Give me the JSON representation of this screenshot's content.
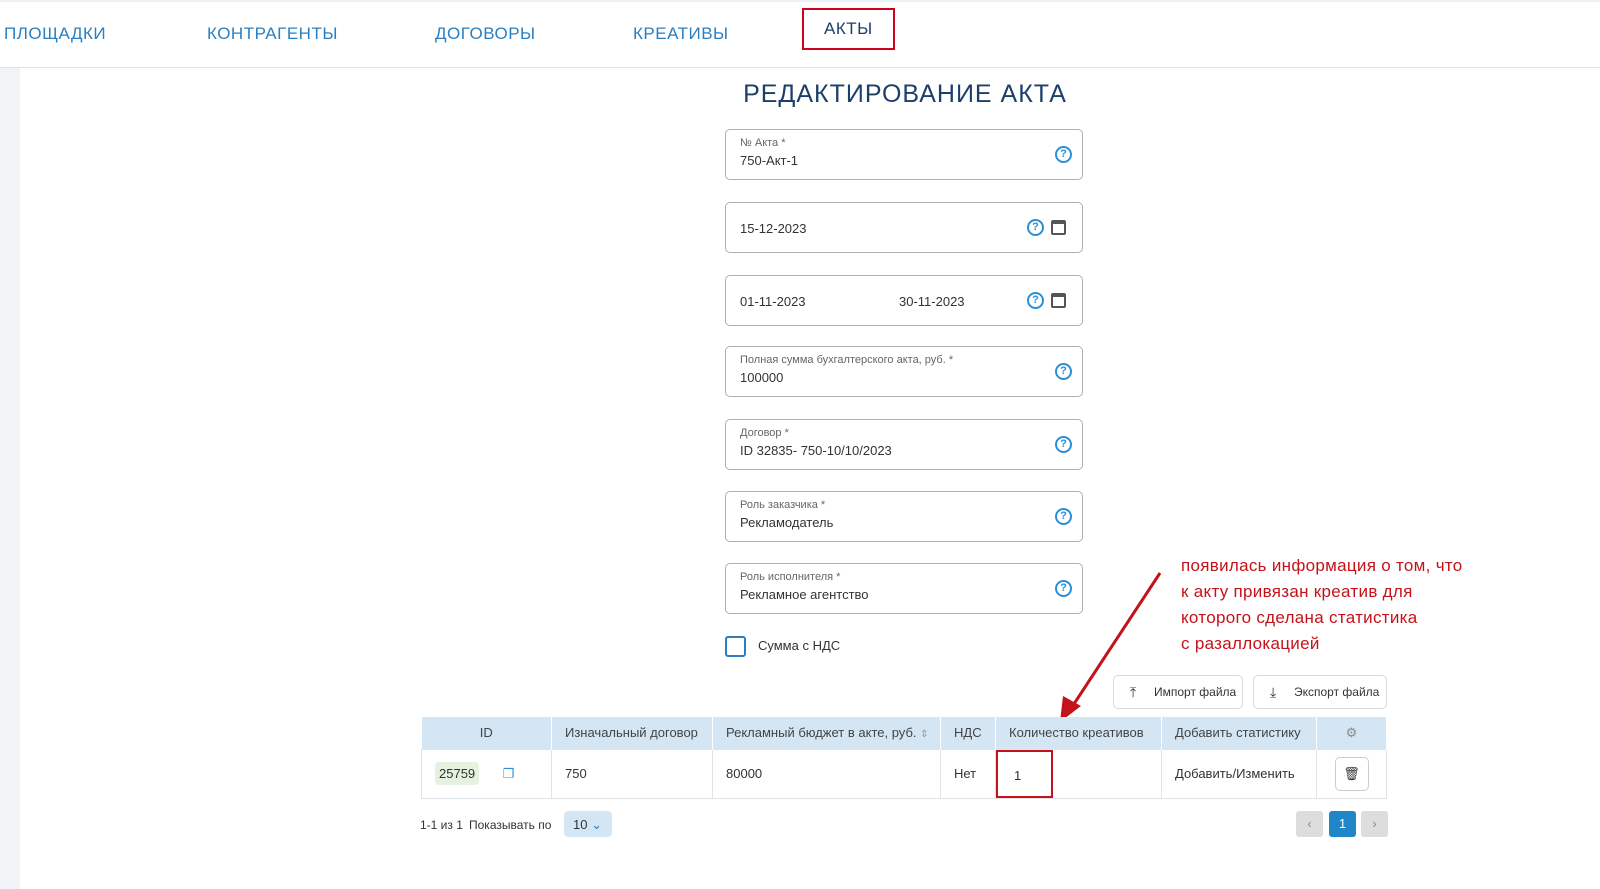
{
  "nav": {
    "items": [
      "ПЛОЩАДКИ",
      "КОНТРАГЕНТЫ",
      "ДОГОВОРЫ",
      "КРЕАТИВЫ",
      "АКТЫ"
    ]
  },
  "title": "РЕДАКТИРОВАНИЕ АКТА",
  "form": {
    "act_no_label": "№ Акта *",
    "act_no": "750-Акт-1",
    "date": "15-12-2023",
    "period_start": "01-11-2023",
    "period_end": "30-11-2023",
    "sum_label": "Полная сумма бухгалтерского акта, руб. *",
    "sum": "100000",
    "contract_label": "Договор *",
    "contract": "ID 32835- 750-10/10/2023",
    "customer_role_label": "Роль заказчика *",
    "customer_role": "Рекламодатель",
    "executor_role_label": "Роль исполнителя *",
    "executor_role": "Рекламное агентство",
    "vat_checkbox": "Сумма с НДС"
  },
  "buttons": {
    "import": "Импорт файла",
    "export": "Экспорт файла"
  },
  "table": {
    "headers": [
      "ID",
      "Изначальный договор",
      "Рекламный бюджет в акте, руб.",
      "НДС",
      "Количество креативов",
      "Добавить статистику"
    ],
    "rows": [
      {
        "id": "25759",
        "contract": "750",
        "budget": "80000",
        "vat": "Нет",
        "creatives": "1",
        "action": "Добавить/Изменить"
      }
    ]
  },
  "pagination": {
    "range": "1-1 из 1",
    "show_label": "Показывать по",
    "page_size": "10",
    "current": "1"
  },
  "annotation": "появилась информация о том, что\nк акту привязан креатив для\nкоторого сделана статистика\nс разаллокацией",
  "colors": {
    "accent": "#2b7fc0",
    "annotation": "#c4121a"
  }
}
